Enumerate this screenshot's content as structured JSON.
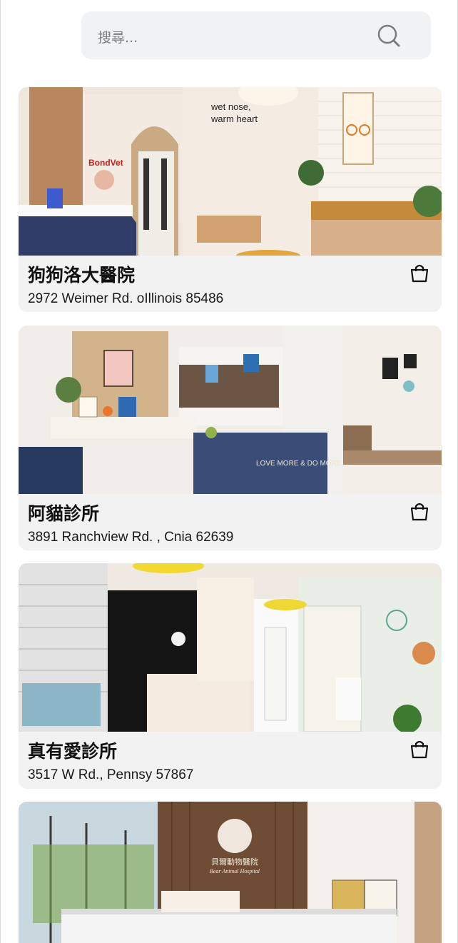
{
  "search": {
    "placeholder": "搜尋...",
    "icon": "search-icon"
  },
  "clinics": [
    {
      "name": "狗狗洛大醫院",
      "address": "2972 Weimer Rd. oIllinois 85486",
      "photo_text": [
        "wet nose,",
        "warm heart",
        "BondVet"
      ],
      "icon": "shopping-bag-icon"
    },
    {
      "name": "阿貓診所",
      "address": "3891 Ranchview Rd. , Cnia 62639",
      "photo_text": [
        "LOVE MORE & DO MORE."
      ],
      "icon": "shopping-bag-icon"
    },
    {
      "name": "真有愛診所",
      "address": "3517 W Rd., Pennsy 57867",
      "icon": "shopping-bag-icon"
    },
    {
      "photo_text": [
        "貝爾動物醫院",
        "Bear Animal Hospital"
      ]
    }
  ]
}
